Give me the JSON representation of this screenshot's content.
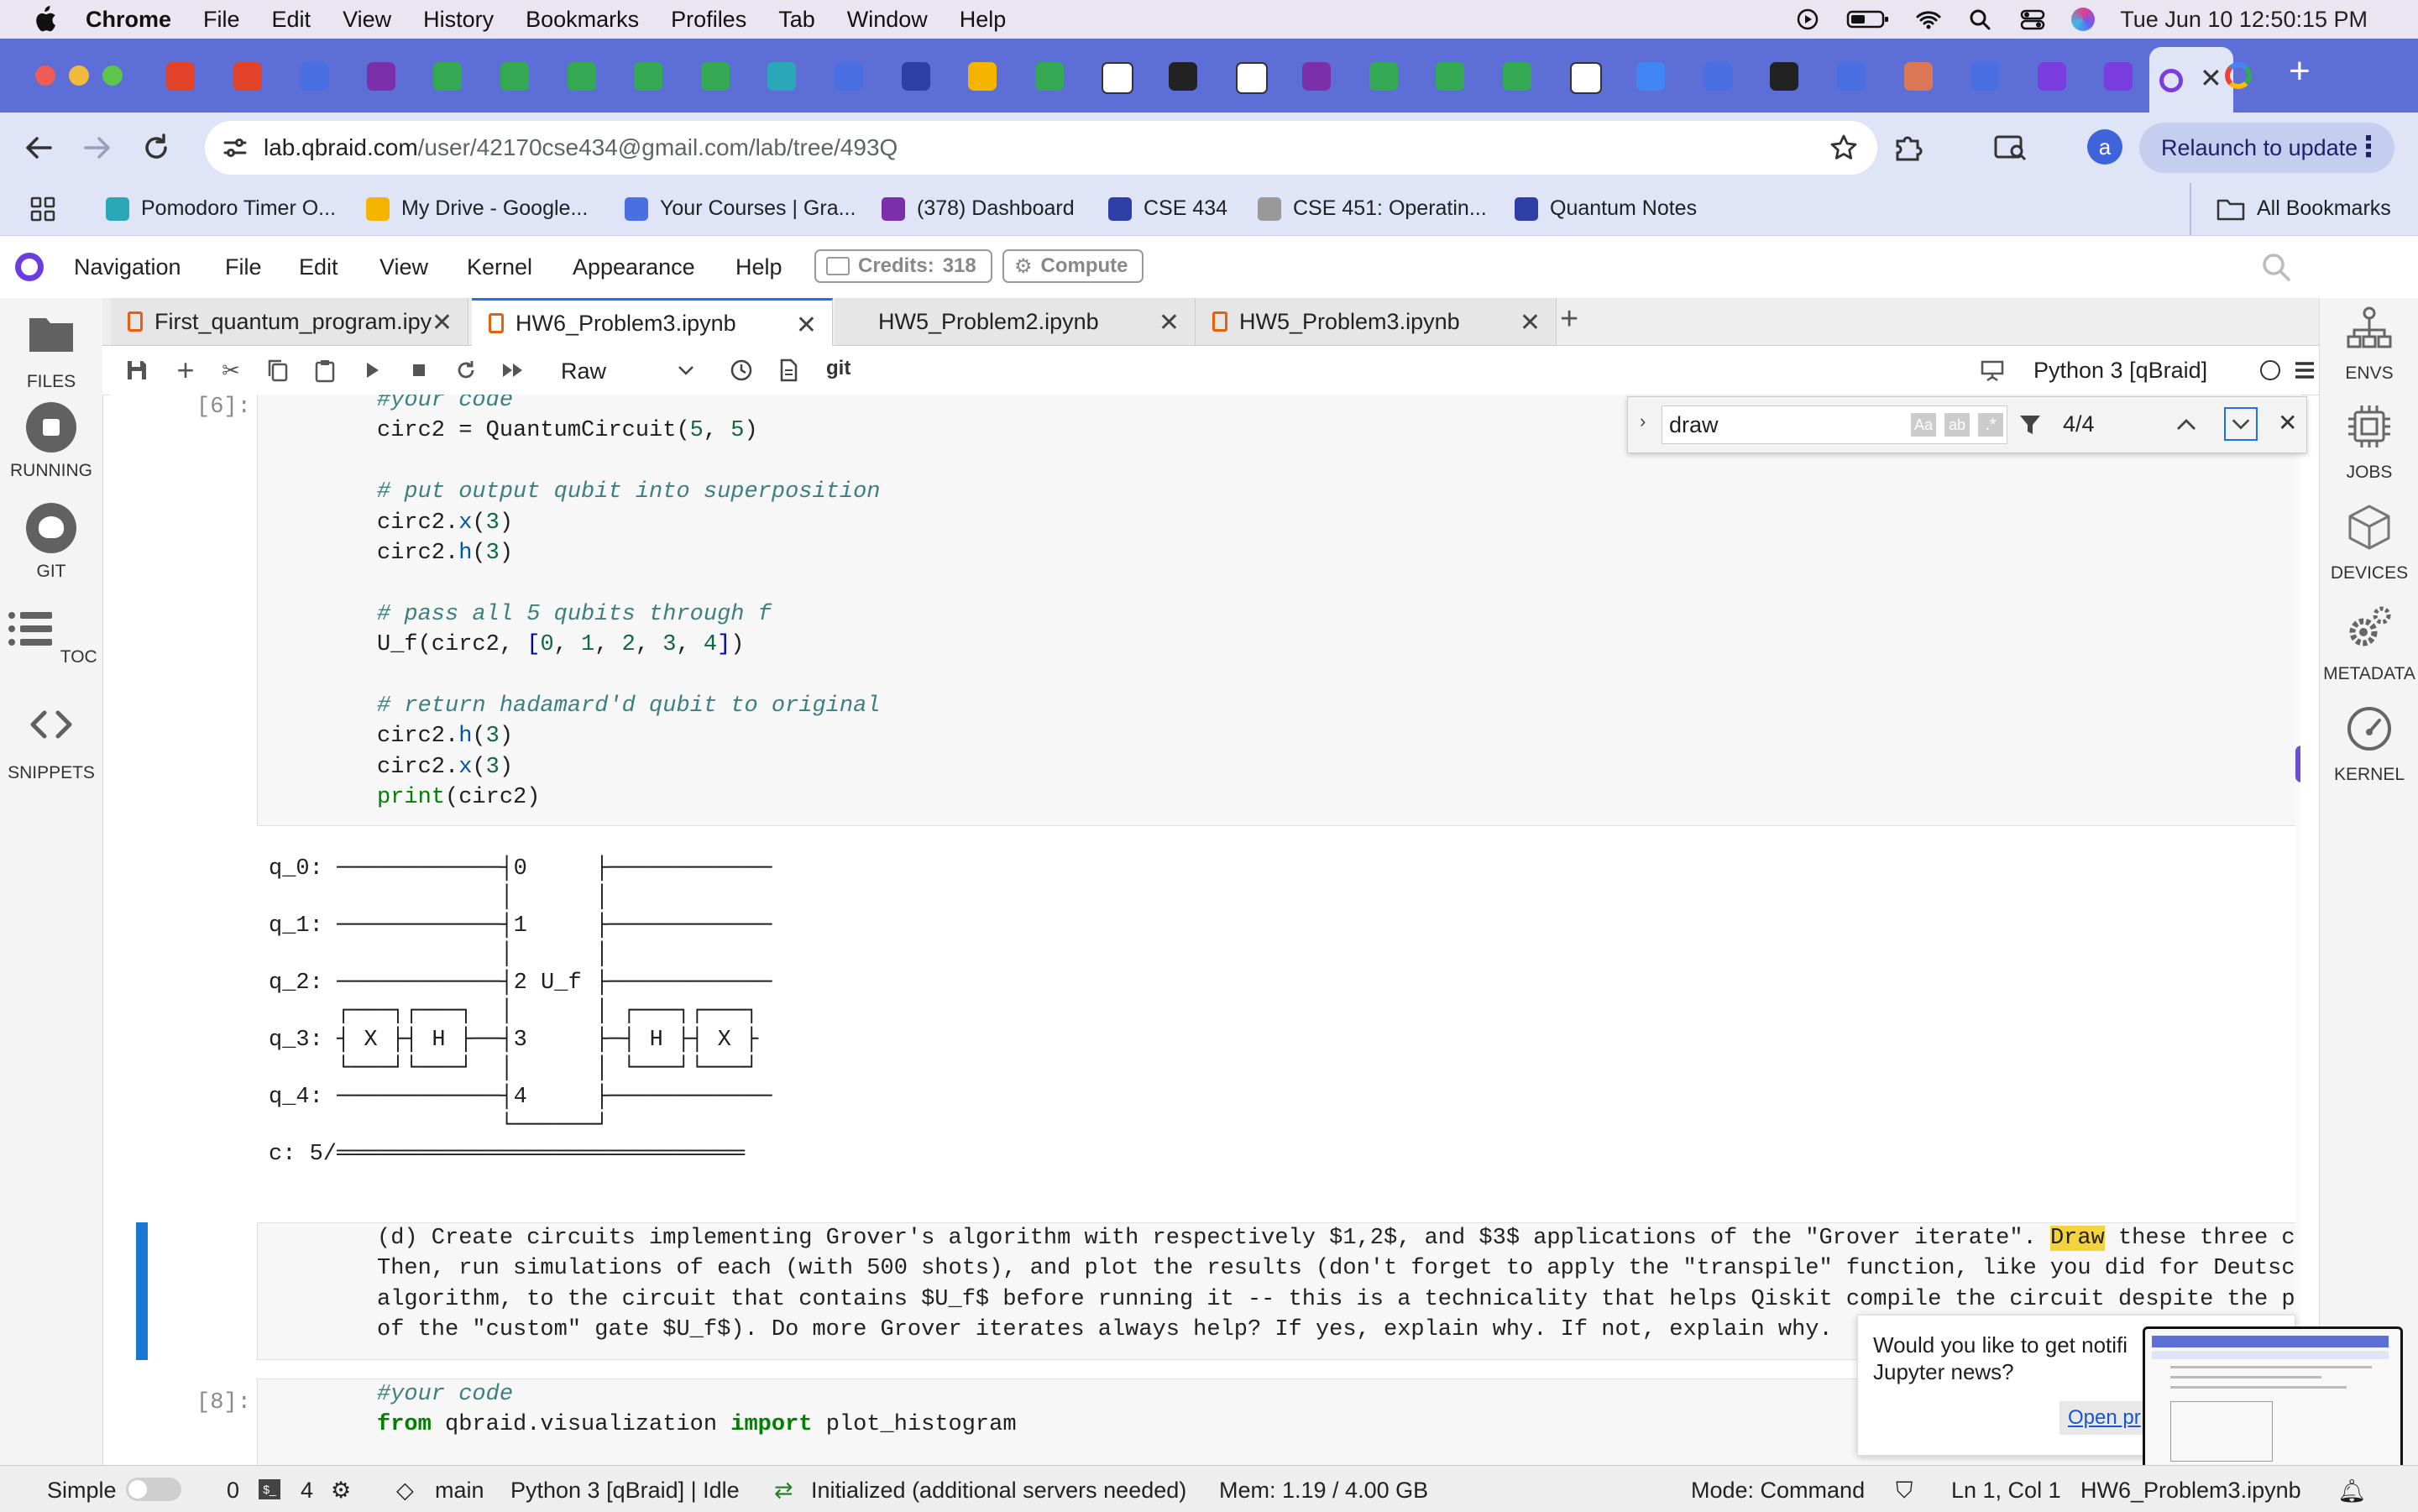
{
  "menubar": {
    "app": "Chrome",
    "items": [
      "File",
      "Edit",
      "View",
      "History",
      "Bookmarks",
      "Profiles",
      "Tab",
      "Window",
      "Help"
    ],
    "clock": "Tue Jun 10  12:50:15 PM"
  },
  "browser": {
    "url_host": "lab.qbraid.com",
    "url_path": "/user/42170cse434@gmail.com/lab/tree/493Q",
    "relaunch_label": "Relaunch to update",
    "profile_initial": "a",
    "bookmarks": [
      {
        "label": "Pomodoro Timer O...",
        "color": "#2aa8b8"
      },
      {
        "label": "My Drive - Google...",
        "color": "#f4b400"
      },
      {
        "label": "Your Courses | Gra...",
        "color": "#4a6fe3"
      },
      {
        "label": "(378) Dashboard",
        "color": "#7b2fa8"
      },
      {
        "label": "CSE 434",
        "color": "#2f3fa8"
      },
      {
        "label": "CSE 451: Operatin...",
        "color": "#999999"
      },
      {
        "label": "Quantum Notes",
        "color": "#2f3fa8"
      }
    ],
    "all_bookmarks": "All Bookmarks"
  },
  "app": {
    "menu": [
      "Navigation",
      "File",
      "Edit",
      "View",
      "Kernel",
      "Appearance",
      "Help"
    ],
    "credits_label": "Credits:",
    "credits_value": "318",
    "compute_label": "Compute"
  },
  "left_sidebar": [
    {
      "label": "FILES"
    },
    {
      "label": "RUNNING"
    },
    {
      "label": "GIT"
    },
    {
      "label": "TOC"
    },
    {
      "label": "SNIPPETS"
    }
  ],
  "right_sidebar": [
    {
      "label": "ENVS"
    },
    {
      "label": "JOBS"
    },
    {
      "label": "DEVICES"
    },
    {
      "label": "METADATA"
    },
    {
      "label": "KERNEL"
    }
  ],
  "notebook_tabs": [
    {
      "label": "First_quantum_program.ipy"
    },
    {
      "label": "HW6_Problem3.ipynb"
    },
    {
      "label": "HW5_Problem2.ipynb"
    },
    {
      "label": "HW5_Problem3.ipynb"
    }
  ],
  "toolbar": {
    "cell_type": "Raw",
    "git_label": "git",
    "kernel_name": "Python 3 [qBraid]"
  },
  "find": {
    "query": "draw",
    "count": "4/4"
  },
  "cells": {
    "cell6_prompt": "[6]:",
    "cell6_code": [
      "#your code",
      "circ2 = QuantumCircuit(5, 5)",
      "",
      "# put output qubit into superposition",
      "circ2.x(3)",
      "circ2.h(3)",
      "",
      "# pass all 5 qubits through f",
      "U_f(circ2, [0, 1, 2, 3, 4])",
      "",
      "# return hadamard'd qubit to original",
      "circ2.h(3)",
      "circ2.x(3)",
      "print(circ2)"
    ],
    "circuit_output": [
      "q_0: ────────────┤0     ├────────────",
      "                 │      │",
      "q_1: ────────────┤1     ├────────────",
      "                 │      │",
      "q_2: ────────────┤2 U_f ├────────────",
      "     ┌───┐┌───┐  │      │ ┌───┐┌───┐",
      "q_3: ┤ X ├┤ H ├──┤3     ├─┤ H ├┤ X ├",
      "     └───┘└───┘  │      │ └───┘└───┘",
      "q_4: ────────────┤4     ├────────────",
      "                 └──────┘",
      "c: 5/══════════════════════════════"
    ],
    "markdown_line1_pre": "(d) Create circuits implementing Grover's algorithm with respectively $1,2$, and $3$ applications of the \"Grover iterate\". ",
    "markdown_highlight": "Draw",
    "markdown_line1_post": " these three circuits.",
    "markdown_lines": [
      "Then, run simulations of each (with 500 shots), and plot the results (don't forget to apply the \"transpile\" function, like you did for Deutsch's",
      "algorithm, to the circuit that contains $U_f$ before running it -- this is a technicality that helps Qiskit compile the circuit despite the presence",
      "of the \"custom\" gate $U_f$). Do more Grover iterates always help? If yes, explain why. If not, explain why."
    ],
    "cell8_prompt": "[8]:",
    "cell8_line1": "#your code",
    "cell8_from": "from",
    "cell8_module": " qbraid.visualization ",
    "cell8_import": "import",
    "cell8_name": " plot_histogram"
  },
  "notification": {
    "text_line1": "Would you like to get notifi",
    "text_line2": "Jupyter news?",
    "button": "Open pr"
  },
  "status": {
    "mode_label": "Simple",
    "terminals": "0",
    "kernels": "4",
    "branch": "main",
    "kernel_state": "Python 3 [qBraid] | Idle",
    "lsp": "Initialized (additional servers needed)",
    "mem": "Mem: 1.19 / 4.00 GB",
    "cmd_mode": "Mode: Command",
    "cursor": "Ln 1, Col 1",
    "file": "HW6_Problem3.ipynb"
  },
  "colors": {
    "tab_strip": "#5d6fd6",
    "accent": "#1a73e8",
    "highlight": "#f5d33c",
    "active_cell_bar": "#1976d2",
    "scroll_thumb": "#6b4fd8"
  }
}
